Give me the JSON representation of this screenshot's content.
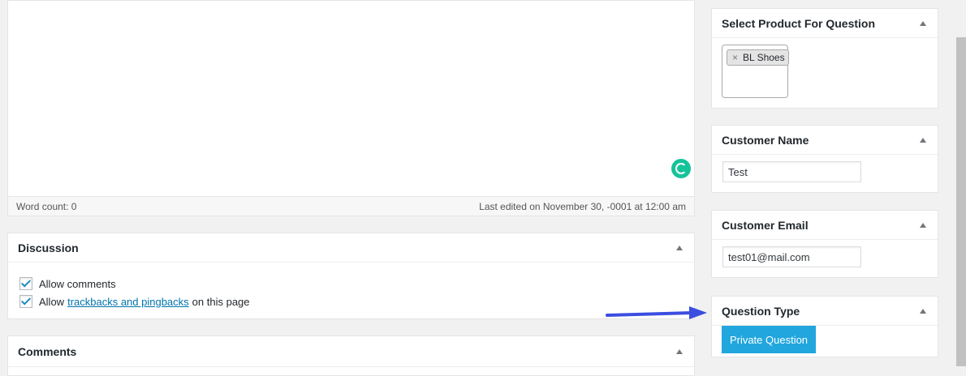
{
  "editor": {
    "word_count": "Word count: 0",
    "last_edited": "Last edited on November 30, -0001 at 12:00 am"
  },
  "discussion": {
    "title": "Discussion",
    "allow_comments": "Allow comments",
    "allow_prefix": "Allow",
    "trackbacks_link": "trackbacks and pingbacks",
    "allow_suffix": "on this page"
  },
  "comments": {
    "title": "Comments"
  },
  "select_product": {
    "title": "Select Product For Question",
    "selected": [
      "BL Shoes"
    ],
    "remove_glyph": "×"
  },
  "customer_name": {
    "title": "Customer Name",
    "value": "Test"
  },
  "customer_email": {
    "title": "Customer Email",
    "value": "test01@mail.com"
  },
  "question_type": {
    "title": "Question Type",
    "button_label": "Private Question"
  },
  "colors": {
    "accent_button": "#21a6dd",
    "arrow": "#3b4ee0",
    "grammarly": "#15c39a",
    "link": "#0073aa"
  }
}
